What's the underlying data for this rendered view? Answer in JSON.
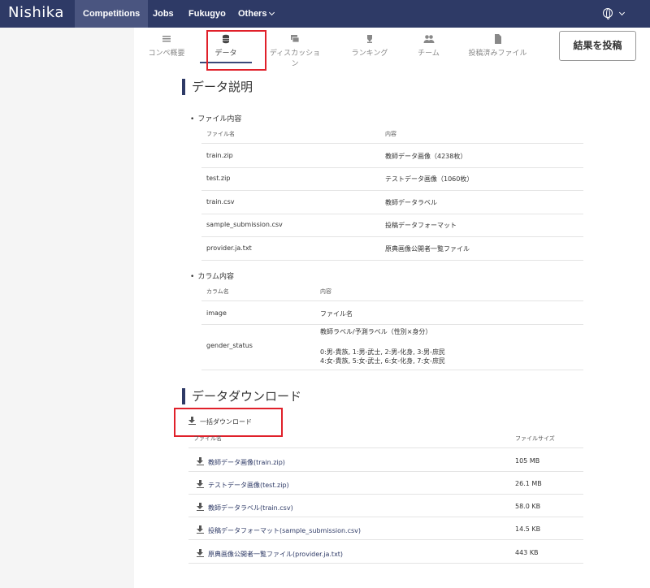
{
  "nav": {
    "logo": "Nishika",
    "items": [
      {
        "label": "Competitions"
      },
      {
        "label": "Jobs"
      },
      {
        "label": "Fukugyo"
      },
      {
        "label": "Others"
      }
    ]
  },
  "tabs": [
    {
      "label": "コンペ概要",
      "icon": "list-icon"
    },
    {
      "label": "データ",
      "icon": "database-icon"
    },
    {
      "label": "ディスカッション",
      "icon": "chat-icon"
    },
    {
      "label": "ランキング",
      "icon": "trophy-icon"
    },
    {
      "label": "チーム",
      "icon": "team-icon"
    },
    {
      "label": "投稿済みファイル",
      "icon": "file-icon"
    }
  ],
  "post_button": "結果を投稿",
  "data_description": {
    "title": "データ説明",
    "files_heading": "ファイル内容",
    "files_columns": [
      "ファイル名",
      "内容"
    ],
    "files": [
      {
        "name": "train.zip",
        "desc": "教師データ画像（4238枚）"
      },
      {
        "name": "test.zip",
        "desc": "テストデータ画像（1060枚）"
      },
      {
        "name": "train.csv",
        "desc": "教師データラベル"
      },
      {
        "name": "sample_submission.csv",
        "desc": "投稿データフォーマット"
      },
      {
        "name": "provider.ja.txt",
        "desc": "原典画像公開者一覧ファイル"
      }
    ],
    "columns_heading": "カラム内容",
    "columns_columns": [
      "カラム名",
      "内容"
    ],
    "columns": [
      {
        "name": "image",
        "lines": [
          "ファイル名"
        ]
      },
      {
        "name": "gender_status",
        "lines": [
          "教師ラベル/予測ラベル（性別×身分）",
          "",
          "0:男-貴族, 1:男-武士, 2:男-化身, 3:男-庶民",
          "4:女-貴族, 5:女-武士, 6:女-化身, 7:女-庶民"
        ]
      }
    ]
  },
  "download": {
    "title": "データダウンロード",
    "all_label": "一括ダウンロード",
    "columns": [
      "ファイル名",
      "ファイルサイズ"
    ],
    "files": [
      {
        "label": "教師データ画像(train.zip)",
        "size": "105 MB"
      },
      {
        "label": "テストデータ画像(test.zip)",
        "size": "26.1 MB"
      },
      {
        "label": "教師データラベル(train.csv)",
        "size": "58.0 KB"
      },
      {
        "label": "投稿データフォーマット(sample_submission.csv)",
        "size": "14.5 KB"
      },
      {
        "label": "原典画像公開者一覧ファイル(provider.ja.txt)",
        "size": "443 KB"
      }
    ]
  },
  "colors": {
    "nav_bg": "#2e3a66",
    "highlight": "#e0202a"
  }
}
